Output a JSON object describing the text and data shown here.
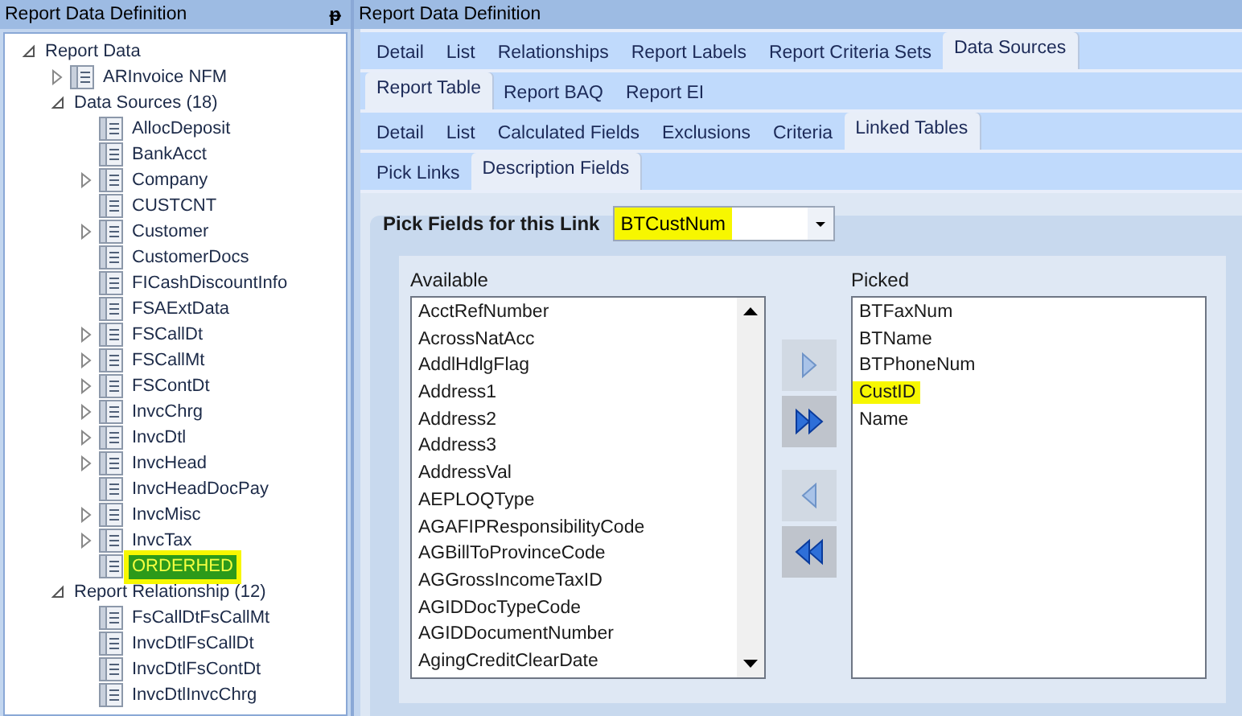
{
  "tree_panel": {
    "title": "Report Data Definition",
    "pin": "ᵽ",
    "tree": [
      {
        "label": "Report Data",
        "icon": false,
        "expanded": true,
        "selected": false,
        "highlighted": false,
        "children": [
          {
            "label": "ARInvoice NFM",
            "icon": true,
            "expanded": false,
            "selected": false,
            "highlighted": false
          },
          {
            "label": "Data Sources (18)",
            "icon": false,
            "expanded": true,
            "selected": false,
            "highlighted": false,
            "children": [
              {
                "label": "AllocDeposit",
                "icon": true,
                "selected": false,
                "highlighted": false
              },
              {
                "label": "BankAcct",
                "icon": true,
                "selected": false,
                "highlighted": false
              },
              {
                "label": "Company",
                "icon": true,
                "expanded": false,
                "selected": false,
                "highlighted": false
              },
              {
                "label": "CUSTCNT",
                "icon": true,
                "selected": false,
                "highlighted": false
              },
              {
                "label": "Customer",
                "icon": true,
                "expanded": false,
                "selected": false,
                "highlighted": false
              },
              {
                "label": "CustomerDocs",
                "icon": true,
                "selected": false,
                "highlighted": false
              },
              {
                "label": "FICashDiscountInfo",
                "icon": true,
                "selected": false,
                "highlighted": false
              },
              {
                "label": "FSAExtData",
                "icon": true,
                "selected": false,
                "highlighted": false
              },
              {
                "label": "FSCallDt",
                "icon": true,
                "expanded": false,
                "selected": false,
                "highlighted": false
              },
              {
                "label": "FSCallMt",
                "icon": true,
                "expanded": false,
                "selected": false,
                "highlighted": false
              },
              {
                "label": "FSContDt",
                "icon": true,
                "expanded": false,
                "selected": false,
                "highlighted": false
              },
              {
                "label": "InvcChrg",
                "icon": true,
                "expanded": false,
                "selected": false,
                "highlighted": false
              },
              {
                "label": "InvcDtl",
                "icon": true,
                "expanded": false,
                "selected": false,
                "highlighted": false
              },
              {
                "label": "InvcHead",
                "icon": true,
                "expanded": false,
                "selected": false,
                "highlighted": false
              },
              {
                "label": "InvcHeadDocPay",
                "icon": true,
                "selected": false,
                "highlighted": false
              },
              {
                "label": "InvcMisc",
                "icon": true,
                "expanded": false,
                "selected": false,
                "highlighted": false
              },
              {
                "label": "InvcTax",
                "icon": true,
                "expanded": false,
                "selected": false,
                "highlighted": false
              },
              {
                "label": "ORDERHED",
                "icon": true,
                "selected": true,
                "highlighted": true
              }
            ]
          },
          {
            "label": "Report Relationship (12)",
            "icon": false,
            "expanded": true,
            "selected": false,
            "highlighted": false,
            "children": [
              {
                "label": "FsCallDtFsCallMt",
                "icon": true,
                "selected": false,
                "highlighted": false
              },
              {
                "label": "InvcDtlFsCallDt",
                "icon": true,
                "selected": false,
                "highlighted": false
              },
              {
                "label": "InvcDtlFsContDt",
                "icon": true,
                "selected": false,
                "highlighted": false
              },
              {
                "label": "InvcDtlInvcChrg",
                "icon": true,
                "selected": false,
                "highlighted": false
              }
            ]
          }
        ]
      }
    ]
  },
  "main_panel": {
    "title": "Report Data Definition",
    "tab_rows": [
      [
        {
          "label": "Detail",
          "selected": false
        },
        {
          "label": "List",
          "selected": false
        },
        {
          "label": "Relationships",
          "selected": false
        },
        {
          "label": "Report Labels",
          "selected": false
        },
        {
          "label": "Report Criteria Sets",
          "selected": false
        },
        {
          "label": "Data Sources",
          "selected": true
        }
      ],
      [
        {
          "label": "Report Table",
          "selected": true
        },
        {
          "label": "Report BAQ",
          "selected": false
        },
        {
          "label": "Report EI",
          "selected": false
        }
      ],
      [
        {
          "label": "Detail",
          "selected": false
        },
        {
          "label": "List",
          "selected": false
        },
        {
          "label": "Calculated Fields",
          "selected": false
        },
        {
          "label": "Exclusions",
          "selected": false
        },
        {
          "label": "Criteria",
          "selected": false
        },
        {
          "label": "Linked Tables",
          "selected": true
        }
      ],
      [
        {
          "label": "Pick Links",
          "selected": false
        },
        {
          "label": "Description Fields",
          "selected": true
        }
      ]
    ],
    "pick_label": "Pick Fields for this Link",
    "link_dropdown": {
      "value": "BTCustNum",
      "highlighted": true
    },
    "available": {
      "label": "Available",
      "items": [
        "AcctRefNumber",
        "AcrossNatAcc",
        "AddlHdlgFlag",
        "Address1",
        "Address2",
        "Address3",
        "AddressVal",
        "AEPLOQType",
        "AGAFIPResponsibilityCode",
        "AGBillToProvinceCode",
        "AGGrossIncomeTaxID",
        "AGIDDocTypeCode",
        "AGIDDocumentNumber",
        "AgingCreditClearDate"
      ]
    },
    "move_buttons": [
      {
        "kind": "add",
        "disabled": true
      },
      {
        "kind": "add_all",
        "disabled": false
      },
      {
        "kind": "remove",
        "disabled": true
      },
      {
        "kind": "remove_all",
        "disabled": false
      }
    ],
    "picked": {
      "label": "Picked",
      "items": [
        {
          "label": "BTFaxNum",
          "highlighted": false
        },
        {
          "label": "BTName",
          "highlighted": false
        },
        {
          "label": "BTPhoneNum",
          "highlighted": false
        },
        {
          "label": "CustID",
          "highlighted": true
        },
        {
          "label": "Name",
          "highlighted": false
        }
      ]
    }
  }
}
